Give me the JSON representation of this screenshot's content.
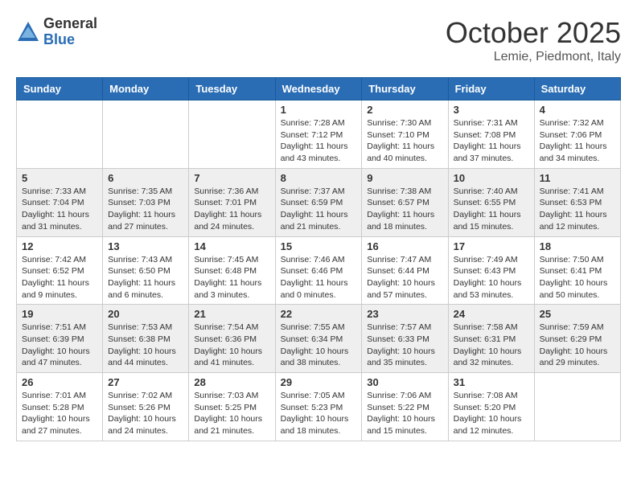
{
  "header": {
    "logo_general": "General",
    "logo_blue": "Blue",
    "month_title": "October 2025",
    "location": "Lemie, Piedmont, Italy"
  },
  "days_of_week": [
    "Sunday",
    "Monday",
    "Tuesday",
    "Wednesday",
    "Thursday",
    "Friday",
    "Saturday"
  ],
  "weeks": [
    [
      {
        "day": "",
        "info": ""
      },
      {
        "day": "",
        "info": ""
      },
      {
        "day": "",
        "info": ""
      },
      {
        "day": "1",
        "info": "Sunrise: 7:28 AM\nSunset: 7:12 PM\nDaylight: 11 hours and 43 minutes."
      },
      {
        "day": "2",
        "info": "Sunrise: 7:30 AM\nSunset: 7:10 PM\nDaylight: 11 hours and 40 minutes."
      },
      {
        "day": "3",
        "info": "Sunrise: 7:31 AM\nSunset: 7:08 PM\nDaylight: 11 hours and 37 minutes."
      },
      {
        "day": "4",
        "info": "Sunrise: 7:32 AM\nSunset: 7:06 PM\nDaylight: 11 hours and 34 minutes."
      }
    ],
    [
      {
        "day": "5",
        "info": "Sunrise: 7:33 AM\nSunset: 7:04 PM\nDaylight: 11 hours and 31 minutes."
      },
      {
        "day": "6",
        "info": "Sunrise: 7:35 AM\nSunset: 7:03 PM\nDaylight: 11 hours and 27 minutes."
      },
      {
        "day": "7",
        "info": "Sunrise: 7:36 AM\nSunset: 7:01 PM\nDaylight: 11 hours and 24 minutes."
      },
      {
        "day": "8",
        "info": "Sunrise: 7:37 AM\nSunset: 6:59 PM\nDaylight: 11 hours and 21 minutes."
      },
      {
        "day": "9",
        "info": "Sunrise: 7:38 AM\nSunset: 6:57 PM\nDaylight: 11 hours and 18 minutes."
      },
      {
        "day": "10",
        "info": "Sunrise: 7:40 AM\nSunset: 6:55 PM\nDaylight: 11 hours and 15 minutes."
      },
      {
        "day": "11",
        "info": "Sunrise: 7:41 AM\nSunset: 6:53 PM\nDaylight: 11 hours and 12 minutes."
      }
    ],
    [
      {
        "day": "12",
        "info": "Sunrise: 7:42 AM\nSunset: 6:52 PM\nDaylight: 11 hours and 9 minutes."
      },
      {
        "day": "13",
        "info": "Sunrise: 7:43 AM\nSunset: 6:50 PM\nDaylight: 11 hours and 6 minutes."
      },
      {
        "day": "14",
        "info": "Sunrise: 7:45 AM\nSunset: 6:48 PM\nDaylight: 11 hours and 3 minutes."
      },
      {
        "day": "15",
        "info": "Sunrise: 7:46 AM\nSunset: 6:46 PM\nDaylight: 11 hours and 0 minutes."
      },
      {
        "day": "16",
        "info": "Sunrise: 7:47 AM\nSunset: 6:44 PM\nDaylight: 10 hours and 57 minutes."
      },
      {
        "day": "17",
        "info": "Sunrise: 7:49 AM\nSunset: 6:43 PM\nDaylight: 10 hours and 53 minutes."
      },
      {
        "day": "18",
        "info": "Sunrise: 7:50 AM\nSunset: 6:41 PM\nDaylight: 10 hours and 50 minutes."
      }
    ],
    [
      {
        "day": "19",
        "info": "Sunrise: 7:51 AM\nSunset: 6:39 PM\nDaylight: 10 hours and 47 minutes."
      },
      {
        "day": "20",
        "info": "Sunrise: 7:53 AM\nSunset: 6:38 PM\nDaylight: 10 hours and 44 minutes."
      },
      {
        "day": "21",
        "info": "Sunrise: 7:54 AM\nSunset: 6:36 PM\nDaylight: 10 hours and 41 minutes."
      },
      {
        "day": "22",
        "info": "Sunrise: 7:55 AM\nSunset: 6:34 PM\nDaylight: 10 hours and 38 minutes."
      },
      {
        "day": "23",
        "info": "Sunrise: 7:57 AM\nSunset: 6:33 PM\nDaylight: 10 hours and 35 minutes."
      },
      {
        "day": "24",
        "info": "Sunrise: 7:58 AM\nSunset: 6:31 PM\nDaylight: 10 hours and 32 minutes."
      },
      {
        "day": "25",
        "info": "Sunrise: 7:59 AM\nSunset: 6:29 PM\nDaylight: 10 hours and 29 minutes."
      }
    ],
    [
      {
        "day": "26",
        "info": "Sunrise: 7:01 AM\nSunset: 5:28 PM\nDaylight: 10 hours and 27 minutes."
      },
      {
        "day": "27",
        "info": "Sunrise: 7:02 AM\nSunset: 5:26 PM\nDaylight: 10 hours and 24 minutes."
      },
      {
        "day": "28",
        "info": "Sunrise: 7:03 AM\nSunset: 5:25 PM\nDaylight: 10 hours and 21 minutes."
      },
      {
        "day": "29",
        "info": "Sunrise: 7:05 AM\nSunset: 5:23 PM\nDaylight: 10 hours and 18 minutes."
      },
      {
        "day": "30",
        "info": "Sunrise: 7:06 AM\nSunset: 5:22 PM\nDaylight: 10 hours and 15 minutes."
      },
      {
        "day": "31",
        "info": "Sunrise: 7:08 AM\nSunset: 5:20 PM\nDaylight: 10 hours and 12 minutes."
      },
      {
        "day": "",
        "info": ""
      }
    ]
  ]
}
